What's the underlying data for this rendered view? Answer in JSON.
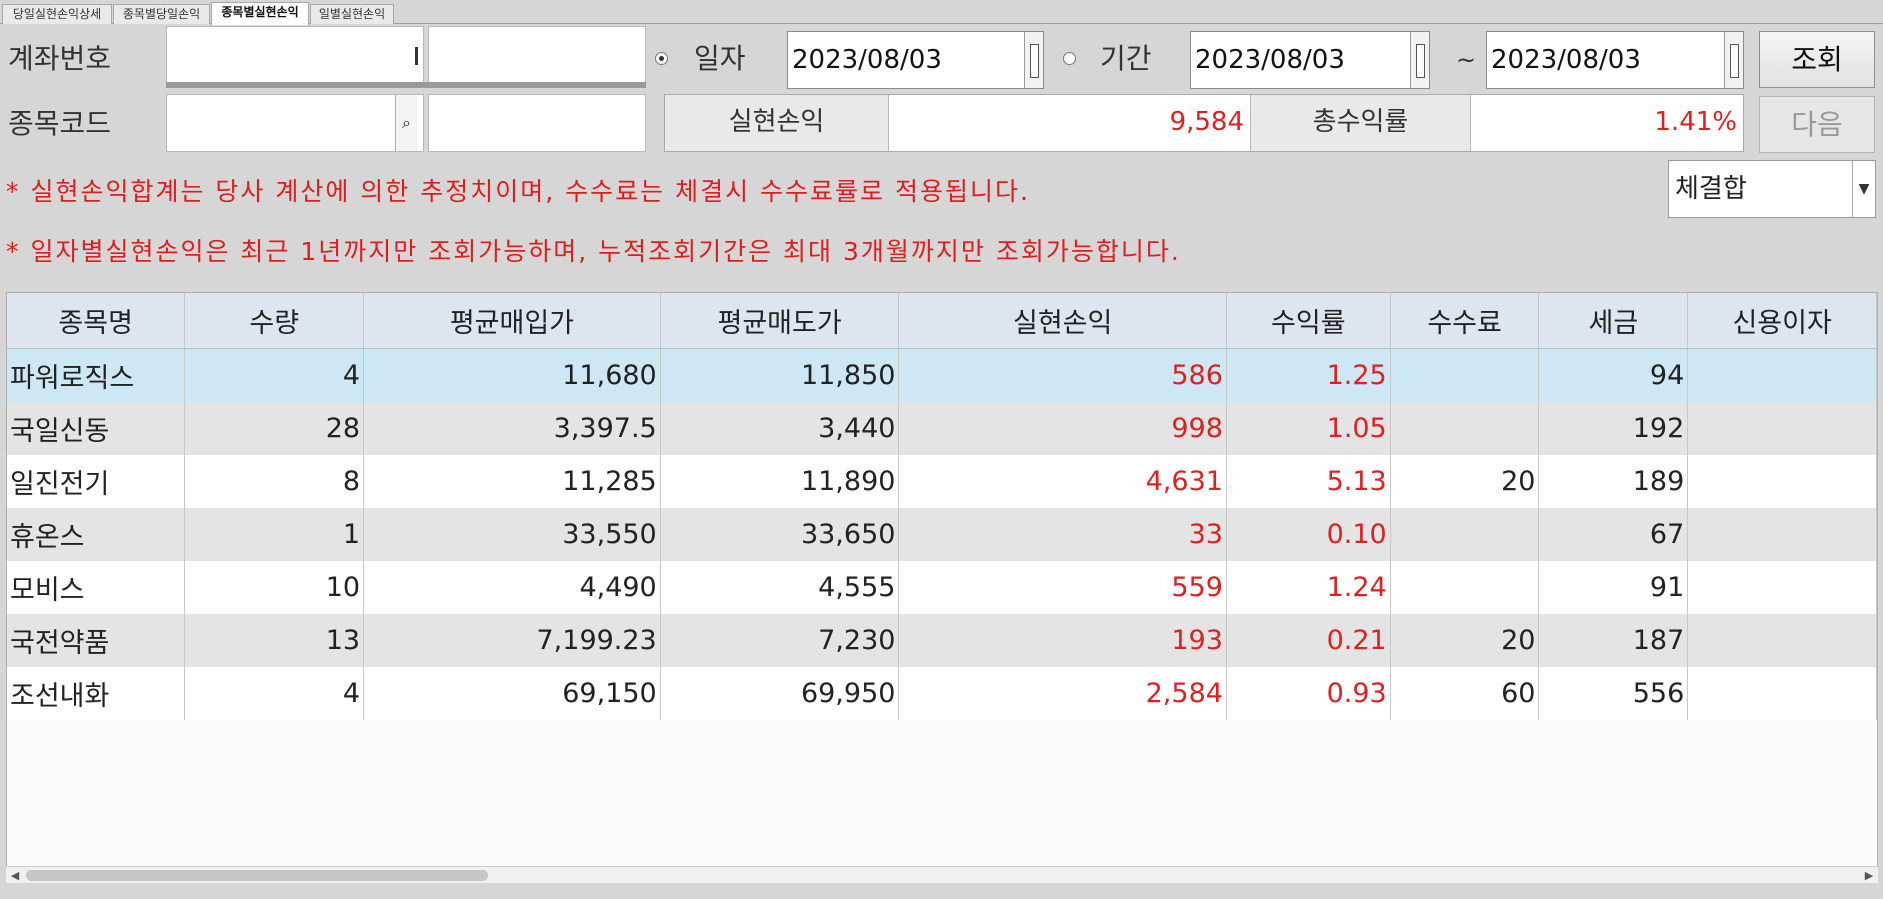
{
  "tabs": [
    {
      "label": "당일실현손익상세"
    },
    {
      "label": "종목별당일손익"
    },
    {
      "label": "종목별실현손익"
    },
    {
      "label": "일별실현손익"
    }
  ],
  "filters": {
    "account_label": "계좌번호",
    "code_label": "종목코드",
    "date_mode_day": "일자",
    "date_mode_period": "기간",
    "day_date": "2023/08/03",
    "period_from": "2023/08/03",
    "period_sep": "~",
    "period_to": "2023/08/03",
    "query_button": "조회",
    "next_button": "다음",
    "combo_value": "체결합"
  },
  "summary": {
    "realized_label": "실현손익",
    "realized_value": "9,584",
    "return_label": "총수익률",
    "return_value": "1.41%"
  },
  "notices": [
    "* 실현손익합계는 당사 계산에 의한 추정치이며, 수수료는 체결시 수수료률로 적용됩니다.",
    "* 일자별실현손익은 최근 1년까지만 조회가능하며, 누적조회기간은 최대 3개월까지만 조회가능합니다."
  ],
  "table": {
    "headers": [
      "종목명",
      "수량",
      "평균매입가",
      "평균매도가",
      "실현손익",
      "수익률",
      "수수료",
      "세금",
      "신용이자"
    ],
    "rows": [
      [
        "파워로직스",
        "4",
        "11,680",
        "11,850",
        "586",
        "1.25",
        "",
        "94",
        ""
      ],
      [
        "국일신동",
        "28",
        "3,397.5",
        "3,440",
        "998",
        "1.05",
        "",
        "192",
        ""
      ],
      [
        "일진전기",
        "8",
        "11,285",
        "11,890",
        "4,631",
        "5.13",
        "20",
        "189",
        ""
      ],
      [
        "휴온스",
        "1",
        "33,550",
        "33,650",
        "33",
        "0.10",
        "",
        "67",
        ""
      ],
      [
        "모비스",
        "10",
        "4,490",
        "4,555",
        "559",
        "1.24",
        "",
        "91",
        ""
      ],
      [
        "국전약품",
        "13",
        "7,199.23",
        "7,230",
        "193",
        "0.21",
        "20",
        "187",
        ""
      ],
      [
        "조선내화",
        "4",
        "69,150",
        "69,950",
        "2,584",
        "0.93",
        "60",
        "556",
        ""
      ]
    ]
  },
  "colors": {
    "positive": "#e02020",
    "selected_row": "#cde8f4",
    "header_bg": "#dde6ef"
  }
}
